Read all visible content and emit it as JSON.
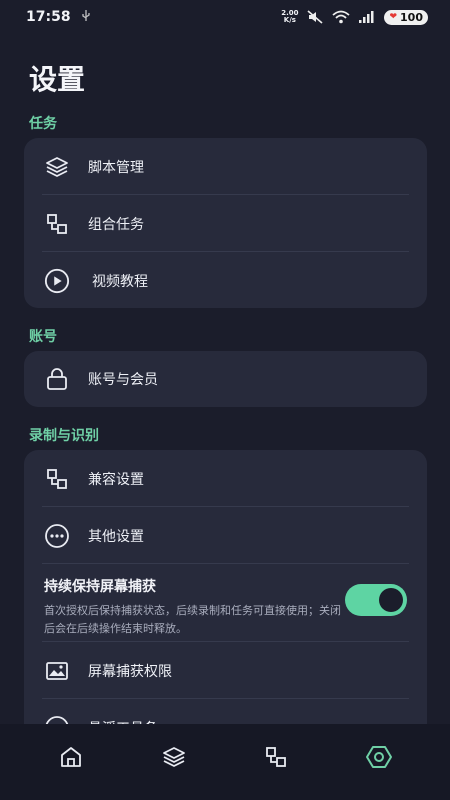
{
  "status": {
    "time": "17:58",
    "usb": "⚲",
    "speed_top": "2.00",
    "speed_bottom": "K/s",
    "battery": "100"
  },
  "title": "设置",
  "sections": {
    "tasks": {
      "label": "任务",
      "items": [
        {
          "label": "脚本管理",
          "icon": "layers-icon"
        },
        {
          "label": "组合任务",
          "icon": "combine-icon"
        },
        {
          "label": "视频教程",
          "icon": "play-icon"
        }
      ]
    },
    "account": {
      "label": "账号",
      "items": [
        {
          "label": "账号与会员",
          "icon": "lock-icon"
        }
      ]
    },
    "recording": {
      "label": "录制与识别",
      "items": [
        {
          "label": "兼容设置",
          "icon": "combine-icon"
        },
        {
          "label": "其他设置",
          "icon": "more-icon"
        }
      ],
      "toggle": {
        "title": "持续保持屏幕捕获",
        "description": "首次授权后保持捕获状态，后续录制和任务可直接使用；关闭后会在后续操作结束时释放。",
        "on": true
      },
      "items2": [
        {
          "label": "屏幕捕获权限",
          "icon": "image-icon"
        },
        {
          "label": "悬浮工具条",
          "icon": "circle-icon"
        }
      ]
    }
  },
  "nav": [
    {
      "name": "home",
      "icon": "home-icon",
      "active": false
    },
    {
      "name": "scripts",
      "icon": "layers-icon",
      "active": false
    },
    {
      "name": "tasks",
      "icon": "combine-icon",
      "active": false
    },
    {
      "name": "settings",
      "icon": "settings-icon",
      "active": true
    }
  ],
  "colors": {
    "background": "#1b1d2b",
    "card": "#272a3b",
    "accent": "#6fd0a6",
    "toggle_on": "#5ed4a3"
  }
}
